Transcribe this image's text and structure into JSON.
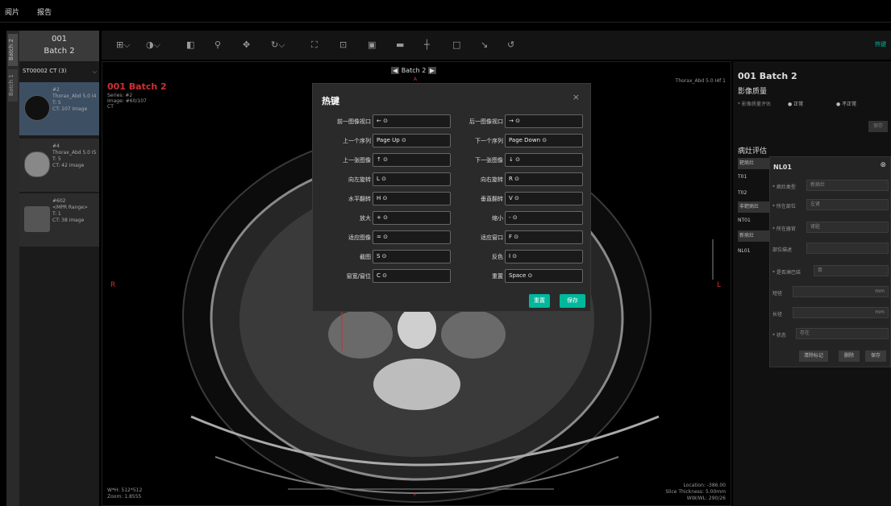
{
  "topbar": {
    "tabs": [
      "阅片",
      "报告"
    ]
  },
  "left_panel": {
    "vertical_tabs": [
      "Batch 2",
      "Batch 1"
    ],
    "header": {
      "number": "001",
      "batch": "Batch 2"
    },
    "study_selector": "ST00002 CT (3)",
    "series": [
      {
        "lines": [
          "#2",
          "Thorax_Abd 5.0 I4",
          "T: 5",
          "CT: 107 image"
        ],
        "selected": true
      },
      {
        "lines": [
          "#4",
          "Thorax_Abd 5.0 I5",
          "T: 5",
          "CT: 42 image"
        ],
        "selected": false
      },
      {
        "lines": [
          "#602",
          "<MPR Range>",
          "T: 1",
          "CT: 38 image"
        ],
        "selected": false
      }
    ]
  },
  "toolbar": {
    "icons": [
      "layout-grid-icon",
      "contrast-icon",
      "invert-icon",
      "zoom-icon",
      "pan-icon",
      "rotate-icon",
      "fit-icon",
      "lock-icon",
      "screenshot-icon",
      "window-level-icon",
      "crosshair-icon",
      "rectangle-icon",
      "arrow-icon",
      "reset-icon"
    ],
    "hotkey_link": "热键"
  },
  "viewer": {
    "title": "001 Batch 2",
    "series_line": "Series: #2",
    "image_line": "Image: #60/107",
    "modality": "CT",
    "top_nav": "Batch 2",
    "top_right_text": "Thorax_Abd 5.0 I4f 1",
    "left_marker": "R",
    "right_marker": "L",
    "bottom_marker": "P",
    "top_marker": "A",
    "bottom_left": [
      "W*H: 512*512",
      "Zoom: 1.8555"
    ],
    "bottom_right": [
      "Location: -386.00",
      "Slice Thickness: 5.00mm",
      "WW/WL: 290/26"
    ]
  },
  "right_panel": {
    "title": "001  Batch 2",
    "quality_title": "影像质量",
    "quality_label": "* 影像质量评估",
    "quality_options": [
      "正常",
      "不正常"
    ],
    "save_btn": "保存",
    "lesion_title": "病灶评估",
    "lesion_items": [
      "靶病灶",
      "T01",
      "T02",
      "非靶病灶",
      "NT01",
      "新病灶",
      "NL01"
    ]
  },
  "nl_popup": {
    "title": "NL01",
    "fields": [
      {
        "label": "* 病灶类型",
        "value": "新病灶"
      },
      {
        "label": "* 所在部位",
        "value": "左肾"
      },
      {
        "label": "* 所在器官",
        "value": "肾脏"
      },
      {
        "label": "部位描述",
        "value": ""
      },
      {
        "label": "* 是否淋巴结",
        "value": "否"
      },
      {
        "label": "短径",
        "value": "mm"
      },
      {
        "label": "长径",
        "value": "mm"
      },
      {
        "label": "* 状态",
        "value": "存在"
      }
    ],
    "buttons": [
      "清除标记",
      "删除",
      "保存"
    ]
  },
  "modal": {
    "title": "热键",
    "close": "×",
    "rows": [
      {
        "left_label": "前一图像视口",
        "left_value": "← ⊙",
        "right_label": "后一图像视口",
        "right_value": "→ ⊙"
      },
      {
        "left_label": "上一个序列",
        "left_value": "Page Up ⊙",
        "right_label": "下一个序列",
        "right_value": "Page Down ⊙"
      },
      {
        "left_label": "上一张图像",
        "left_value": "↑ ⊙",
        "right_label": "下一张图像",
        "right_value": "↓ ⊙"
      },
      {
        "left_label": "向左旋转",
        "left_value": "L ⊙",
        "right_label": "向右旋转",
        "right_value": "R ⊙"
      },
      {
        "left_label": "水平翻转",
        "left_value": "H ⊙",
        "right_label": "垂直翻转",
        "right_value": "V ⊙"
      },
      {
        "left_label": "放大",
        "left_value": "+ ⊙",
        "right_label": "缩小",
        "right_value": "- ⊙"
      },
      {
        "left_label": "适应图像",
        "left_value": "= ⊙",
        "right_label": "适应窗口",
        "right_value": "F ⊙"
      },
      {
        "left_label": "截图",
        "left_value": "S ⊙",
        "right_label": "反色",
        "right_value": "I ⊙"
      },
      {
        "left_label": "窗宽/窗位",
        "left_value": "C ⊙",
        "right_label": "重置",
        "right_value": "Space ⊙"
      }
    ],
    "reset_btn": "重置",
    "save_btn": "保存"
  }
}
